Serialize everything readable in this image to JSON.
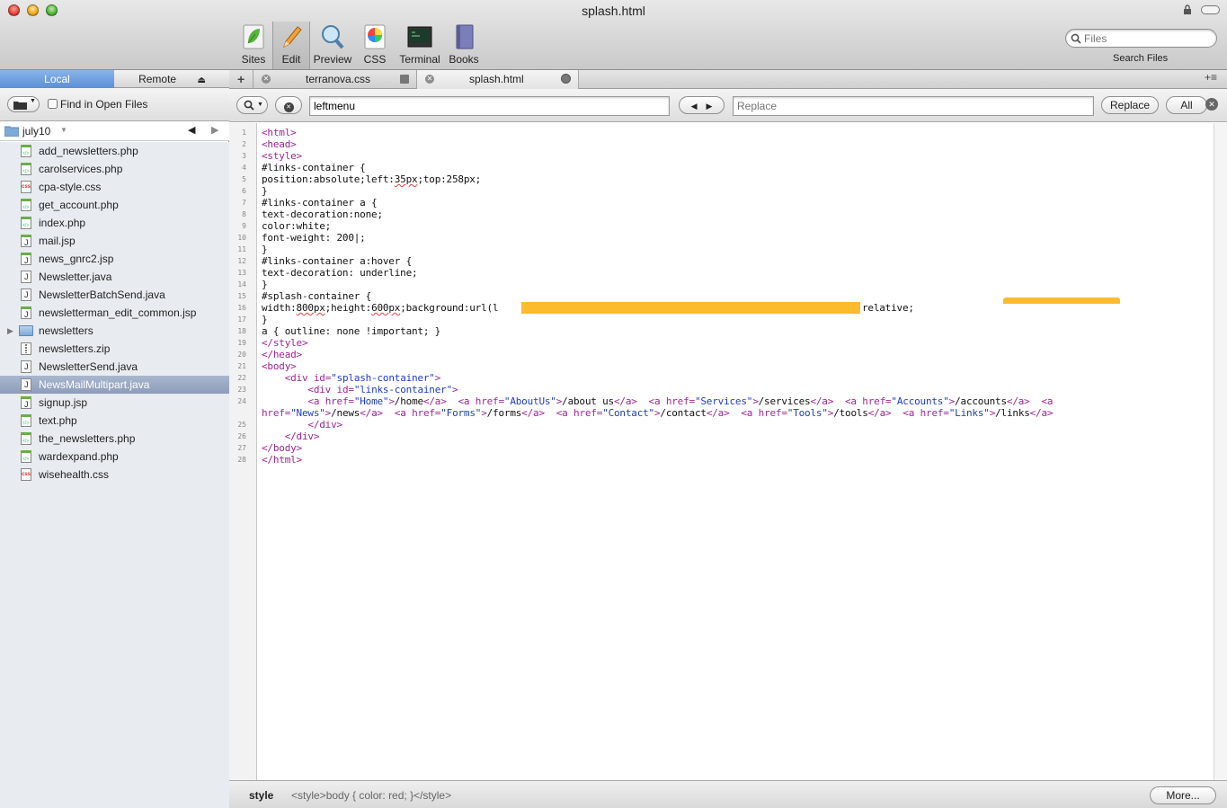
{
  "window": {
    "title": "splash.html"
  },
  "toolbar": {
    "items": [
      {
        "label": "Sites",
        "icon": "sites-leaf-icon"
      },
      {
        "label": "Edit",
        "icon": "pencil-icon"
      },
      {
        "label": "Preview",
        "icon": "magnifier-preview-icon"
      },
      {
        "label": "CSS",
        "icon": "color-wheel-icon"
      },
      {
        "label": "Terminal",
        "icon": "terminal-icon"
      },
      {
        "label": "Books",
        "icon": "book-icon"
      }
    ],
    "search_placeholder": "Files",
    "search_label": "Search Files"
  },
  "sidebar": {
    "tab_local": "Local",
    "tab_remote": "Remote",
    "find_in_open_files": "Find in Open Files",
    "folder": "july10",
    "files": [
      {
        "name": "add_newsletters.php",
        "type": "php"
      },
      {
        "name": "carolservices.php",
        "type": "php"
      },
      {
        "name": "cpa-style.css",
        "type": "css"
      },
      {
        "name": "get_account.php",
        "type": "php"
      },
      {
        "name": "index.php",
        "type": "php"
      },
      {
        "name": "mail.jsp",
        "type": "jsp"
      },
      {
        "name": "news_gnrc2.jsp",
        "type": "jsp"
      },
      {
        "name": "Newsletter.java",
        "type": "java"
      },
      {
        "name": "NewsletterBatchSend.java",
        "type": "java"
      },
      {
        "name": "newsletterman_edit_common.jsp",
        "type": "jsp"
      },
      {
        "name": "newsletters",
        "type": "folder"
      },
      {
        "name": "newsletters.zip",
        "type": "zip"
      },
      {
        "name": "NewsletterSend.java",
        "type": "java"
      },
      {
        "name": "NewsMailMultipart.java",
        "type": "java",
        "selected": true
      },
      {
        "name": "signup.jsp",
        "type": "jsp"
      },
      {
        "name": "text.php",
        "type": "php"
      },
      {
        "name": "the_newsletters.php",
        "type": "php"
      },
      {
        "name": "wardexpand.php",
        "type": "php"
      },
      {
        "name": "wisehealth.css",
        "type": "css"
      }
    ]
  },
  "tabs": [
    {
      "label": "terranova.css"
    },
    {
      "label": "splash.html",
      "active": true
    }
  ],
  "find": {
    "search_value": "leftmenu",
    "replace_placeholder": "Replace",
    "replace_button": "Replace",
    "all_button": "All"
  },
  "editor": {
    "lines": [
      {
        "n": "1",
        "html": "<span class=\"tag\">&lt;html&gt;</span>"
      },
      {
        "n": "2",
        "html": "<span class=\"tag\">&lt;head&gt;</span>"
      },
      {
        "n": "3",
        "html": "<span class=\"tag\">&lt;style&gt;</span>"
      },
      {
        "n": "4",
        "html": "#links-container {"
      },
      {
        "n": "5",
        "html": "position:absolute;left:<span class=\"sq\">35px</span>;top:258px;"
      },
      {
        "n": "6",
        "html": "}"
      },
      {
        "n": "7",
        "html": "#links-container a {"
      },
      {
        "n": "8",
        "html": "text-decoration:none;"
      },
      {
        "n": "9",
        "html": "color:white;"
      },
      {
        "n": "10",
        "html": "font-weight: 200|;"
      },
      {
        "n": "11",
        "html": "}"
      },
      {
        "n": "12",
        "html": "#links-container a:hover {"
      },
      {
        "n": "13",
        "html": "text-decoration: underline;"
      },
      {
        "n": "14",
        "html": "}"
      },
      {
        "n": "15",
        "html": "#splash-container {"
      },
      {
        "n": "16",
        "html": "width:<span class=\"sq\">800px</span>;height:<span class=\"sq\">600px</span>;background:url(l                                     g);margin:0 auto;position:relative;"
      },
      {
        "n": "17",
        "html": "}"
      },
      {
        "n": "18",
        "html": "a { outline: none !important; }"
      },
      {
        "n": "19",
        "html": "<span class=\"tag\">&lt;/style&gt;</span>"
      },
      {
        "n": "20",
        "html": "<span class=\"tag\">&lt;/head&gt;</span>"
      },
      {
        "n": "21",
        "html": "<span class=\"tag\">&lt;body&gt;</span>"
      },
      {
        "n": "22",
        "html": "    <span class=\"tag\">&lt;div</span> <span class=\"attr\">id=</span><span class=\"val\">\"splash-container\"</span><span class=\"tag\">&gt;</span>"
      },
      {
        "n": "23",
        "html": "        <span class=\"tag\">&lt;div</span> <span class=\"attr\">id=</span><span class=\"val\">\"links-container\"</span><span class=\"tag\">&gt;</span>"
      },
      {
        "n": "24",
        "html": "        <span class=\"tag\">&lt;a</span> <span class=\"attr\">href=</span><span class=\"val\">\"Home\"</span><span class=\"tag\">&gt;</span>/home<span class=\"tag\">&lt;/a&gt;</span>  <span class=\"tag\">&lt;a</span> <span class=\"attr\">href=</span><span class=\"val\">\"AboutUs\"</span><span class=\"tag\">&gt;</span>/about us<span class=\"tag\">&lt;/a&gt;</span>  <span class=\"tag\">&lt;a</span> <span class=\"attr\">href=</span><span class=\"val\">\"Services\"</span><span class=\"tag\">&gt;</span>/services<span class=\"tag\">&lt;/a&gt;</span>  <span class=\"tag\">&lt;a</span> <span class=\"attr\">href=</span><span class=\"val\">\"Accounts\"</span><span class=\"tag\">&gt;</span>/accounts<span class=\"tag\">&lt;/a&gt;</span>  <span class=\"tag\">&lt;a</span>"
      },
      {
        "n": "",
        "html": "<span class=\"attr\">href=</span><span class=\"val\">\"News\"</span><span class=\"tag\">&gt;</span>/news<span class=\"tag\">&lt;/a&gt;</span>  <span class=\"tag\">&lt;a</span> <span class=\"attr\">href=</span><span class=\"val\">\"Forms\"</span><span class=\"tag\">&gt;</span>/forms<span class=\"tag\">&lt;/a&gt;</span>  <span class=\"tag\">&lt;a</span> <span class=\"attr\">href=</span><span class=\"val\">\"Contact\"</span><span class=\"tag\">&gt;</span>/contact<span class=\"tag\">&lt;/a&gt;</span>  <span class=\"tag\">&lt;a</span> <span class=\"attr\">href=</span><span class=\"val\">\"Tools\"</span><span class=\"tag\">&gt;</span>/tools<span class=\"tag\">&lt;/a&gt;</span>  <span class=\"tag\">&lt;a</span> <span class=\"attr\">href=</span><span class=\"val\">\"Links\"</span><span class=\"tag\">&gt;</span>/links<span class=\"tag\">&lt;/a&gt;</span>"
      },
      {
        "n": "25",
        "html": "        <span class=\"tag\">&lt;/div&gt;</span>"
      },
      {
        "n": "26",
        "html": "    <span class=\"tag\">&lt;/div&gt;</span>"
      },
      {
        "n": "27",
        "html": "<span class=\"tag\">&lt;/body&gt;</span>"
      },
      {
        "n": "28",
        "html": "<span class=\"tag\">&lt;/html&gt;</span>"
      }
    ]
  },
  "status": {
    "path": "style",
    "hint": "<style>body { color: red; }</style>",
    "more_button": "More..."
  }
}
